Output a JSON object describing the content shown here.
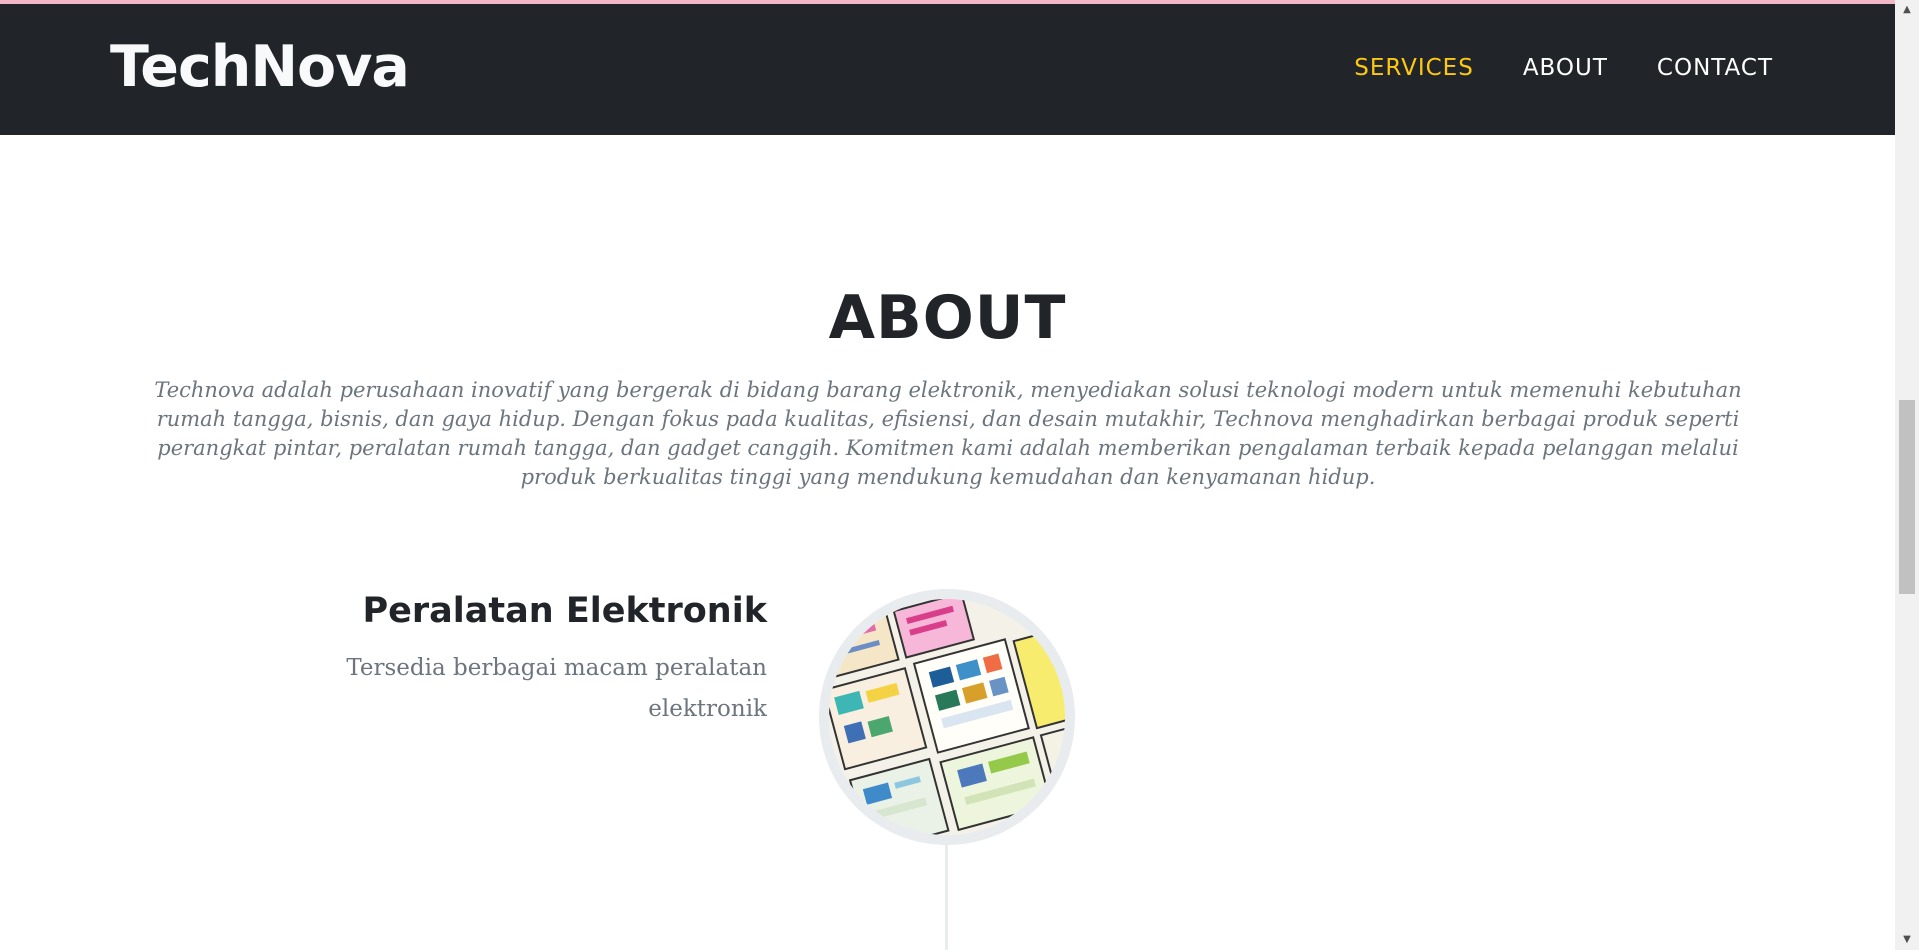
{
  "colors": {
    "navbar": "#212529",
    "accent": "#fec810",
    "text_muted": "#6c757d",
    "heading": "#212529"
  },
  "navbar": {
    "brand": "TechNova",
    "links": [
      {
        "label": "SERVICES",
        "active": true
      },
      {
        "label": "ABOUT",
        "active": false
      },
      {
        "label": "CONTACT",
        "active": false
      }
    ]
  },
  "about": {
    "heading": "ABOUT",
    "subheading": "Technova adalah perusahaan inovatif yang bergerak di bidang barang elektronik, menyediakan solusi teknologi modern untuk memenuhi kebutuhan rumah tangga, bisnis, dan gaya hidup. Dengan fokus pada kualitas, efisiensi, dan desain mutakhir, Technova menghadirkan berbagai produk seperti perangkat pintar, peralatan rumah tangga, dan gadget canggih. Komitmen kami adalah memberikan pengalaman terbaik kepada pelanggan melalui produk berkualitas tinggi yang mendukung kemudahan dan kenyamanan hidup."
  },
  "timeline": [
    {
      "heading": "Peralatan Elektronik",
      "body": "Tersedia berbagai macam peralatan elektronik",
      "image": "wireframe-sketches-image"
    }
  ],
  "scrollbar": {
    "up_icon": "triangle-up-icon",
    "down_icon": "triangle-down-icon",
    "up_glyph": "▲",
    "down_glyph": "▼"
  }
}
